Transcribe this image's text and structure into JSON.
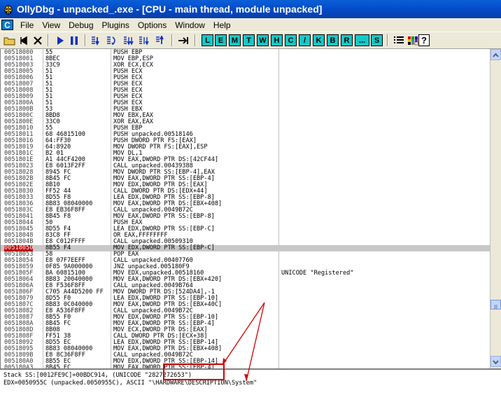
{
  "window": {
    "title": "OllyDbg - unpacked_.exe - [CPU - main thread, module unpacked]"
  },
  "menubar": {
    "mdi_icon_label": "C",
    "items": [
      "File",
      "View",
      "Debug",
      "Plugins",
      "Options",
      "Window",
      "Help"
    ]
  },
  "toolbar": {
    "letter_buttons": [
      "L",
      "E",
      "M",
      "T",
      "W",
      "H",
      "C",
      "/",
      "K",
      "B",
      "R",
      "...",
      "S"
    ],
    "glyph_buttons": [
      "open-icon",
      "restart-icon",
      "close-icon",
      "run-icon",
      "pause-icon",
      "step-into-icon",
      "step-over-icon",
      "trace-into-icon",
      "trace-over-icon",
      "execute-till-return-icon",
      "go-to-icon",
      "list-icon",
      "palette-icon",
      "help-icon"
    ]
  },
  "disassembly": {
    "selected_address": "00518050",
    "rows": [
      {
        "addr": "00518000",
        "hex": "55",
        "dis": "PUSH EBP",
        "com": ""
      },
      {
        "addr": "00518001",
        "hex": "8BEC",
        "dis": "MOV EBP,ESP",
        "com": ""
      },
      {
        "addr": "00518003",
        "hex": "33C9",
        "dis": "XOR ECX,ECX",
        "com": ""
      },
      {
        "addr": "00518005",
        "hex": "51",
        "dis": "PUSH ECX",
        "com": ""
      },
      {
        "addr": "00518006",
        "hex": "51",
        "dis": "PUSH ECX",
        "com": ""
      },
      {
        "addr": "00518007",
        "hex": "51",
        "dis": "PUSH ECX",
        "com": ""
      },
      {
        "addr": "00518008",
        "hex": "51",
        "dis": "PUSH ECX",
        "com": ""
      },
      {
        "addr": "00518009",
        "hex": "51",
        "dis": "PUSH ECX",
        "com": ""
      },
      {
        "addr": "0051800A",
        "hex": "51",
        "dis": "PUSH ECX",
        "com": ""
      },
      {
        "addr": "0051800B",
        "hex": "53",
        "dis": "PUSH EBX",
        "com": ""
      },
      {
        "addr": "0051800C",
        "hex": "8BD8",
        "dis": "MOV EBX,EAX",
        "com": ""
      },
      {
        "addr": "0051800E",
        "hex": "33C0",
        "dis": "XOR EAX,EAX",
        "com": ""
      },
      {
        "addr": "00518010",
        "hex": "55",
        "dis": "PUSH EBP",
        "com": ""
      },
      {
        "addr": "00518011",
        "hex": "68 46815100",
        "dis": "PUSH unpacked.00518146",
        "com": ""
      },
      {
        "addr": "00518016",
        "hex": "64:FF30",
        "dis": "PUSH DWORD PTR FS:[EAX]",
        "com": ""
      },
      {
        "addr": "00518019",
        "hex": "64:8920",
        "dis": "MOV DWORD PTR FS:[EAX],ESP",
        "com": ""
      },
      {
        "addr": "0051801C",
        "hex": "B2 01",
        "dis": "MOV DL,1",
        "com": ""
      },
      {
        "addr": "0051801E",
        "hex": "A1 44CF4200",
        "dis": "MOV EAX,DWORD PTR DS:[42CF44]",
        "com": ""
      },
      {
        "addr": "00518023",
        "hex": "E8 6013F2FF",
        "dis": "CALL unpacked.00439388",
        "com": ""
      },
      {
        "addr": "00518028",
        "hex": "8945 FC",
        "dis": "MOV DWORD PTR SS:[EBP-4],EAX",
        "com": ""
      },
      {
        "addr": "0051802B",
        "hex": "8B45 FC",
        "dis": "MOV EAX,DWORD PTR SS:[EBP-4]",
        "com": ""
      },
      {
        "addr": "0051802E",
        "hex": "8B10",
        "dis": "MOV EDX,DWORD PTR DS:[EAX]",
        "com": ""
      },
      {
        "addr": "00518030",
        "hex": "FF52 44",
        "dis": "CALL DWORD PTR DS:[EDX+44]",
        "com": ""
      },
      {
        "addr": "00518033",
        "hex": "8D55 F8",
        "dis": "LEA EDX,DWORD PTR SS:[EBP-8]",
        "com": ""
      },
      {
        "addr": "00518036",
        "hex": "8B83 08040000",
        "dis": "MOV EAX,DWORD PTR DS:[EBX+408]",
        "com": ""
      },
      {
        "addr": "0051803C",
        "hex": "E8 EB36F8FF",
        "dis": "CALL unpacked.0049B72C",
        "com": ""
      },
      {
        "addr": "00518041",
        "hex": "8B45 F8",
        "dis": "MOV EAX,DWORD PTR SS:[EBP-8]",
        "com": ""
      },
      {
        "addr": "00518044",
        "hex": "50",
        "dis": "PUSH EAX",
        "com": ""
      },
      {
        "addr": "00518045",
        "hex": "8D55 F4",
        "dis": "LEA EDX,DWORD PTR SS:[EBP-C]",
        "com": ""
      },
      {
        "addr": "00518048",
        "hex": "83C8 FF",
        "dis": "OR EAX,FFFFFFFF",
        "com": ""
      },
      {
        "addr": "0051804B",
        "hex": "E8 C012FFFF",
        "dis": "CALL unpacked.00509310",
        "com": ""
      },
      {
        "addr": "00518050",
        "hex": "8B55 F4",
        "dis": "MOV EDX,DWORD PTR SS:[EBP-C]",
        "com": ""
      },
      {
        "addr": "00518053",
        "hex": "58",
        "dis": "POP EAX",
        "com": ""
      },
      {
        "addr": "00518054",
        "hex": "E8 07F7EEFF",
        "dis": "CALL unpacked.00407760",
        "com": ""
      },
      {
        "addr": "00518059",
        "hex": "0F85 9A000000",
        "dis": "JNZ unpacked.005180F9",
        "com": ""
      },
      {
        "addr": "0051805F",
        "hex": "BA 60815100",
        "dis": "MOV EDX,unpacked.00518160",
        "com": "UNICODE \"Registered\""
      },
      {
        "addr": "00518064",
        "hex": "8B83 20040000",
        "dis": "MOV EAX,DWORD PTR DS:[EBX+420]",
        "com": ""
      },
      {
        "addr": "0051806A",
        "hex": "E8 F536F8FF",
        "dis": "CALL unpacked.0049B764",
        "com": ""
      },
      {
        "addr": "0051806F",
        "hex": "C705 A44D5200 FF",
        "dis": "MOV DWORD PTR DS:[524DA4],-1",
        "com": ""
      },
      {
        "addr": "00518079",
        "hex": "8D55 F0",
        "dis": "LEA EDX,DWORD PTR SS:[EBP-10]",
        "com": ""
      },
      {
        "addr": "0051807C",
        "hex": "8B83 0C040000",
        "dis": "MOV EAX,DWORD PTR DS:[EBX+40C]",
        "com": ""
      },
      {
        "addr": "00518082",
        "hex": "E8 A536F8FF",
        "dis": "CALL unpacked.0049B72C",
        "com": ""
      },
      {
        "addr": "00518087",
        "hex": "8B55 F0",
        "dis": "MOV EDX,DWORD PTR SS:[EBP-10]",
        "com": ""
      },
      {
        "addr": "0051808A",
        "hex": "8B45 FC",
        "dis": "MOV EAX,DWORD PTR SS:[EBP-4]",
        "com": ""
      },
      {
        "addr": "0051808D",
        "hex": "8B08",
        "dis": "MOV ECX,DWORD PTR DS:[EAX]",
        "com": ""
      },
      {
        "addr": "0051808F",
        "hex": "FF51 38",
        "dis": "CALL DWORD PTR DS:[ECX+38]",
        "com": ""
      },
      {
        "addr": "00518092",
        "hex": "8D55 EC",
        "dis": "LEA EDX,DWORD PTR SS:[EBP-14]",
        "com": ""
      },
      {
        "addr": "00518095",
        "hex": "8B83 08040000",
        "dis": "MOV EAX,DWORD PTR DS:[EBX+408]",
        "com": ""
      },
      {
        "addr": "0051809B",
        "hex": "E8 8C36F8FF",
        "dis": "CALL unpacked.0049B72C",
        "com": ""
      },
      {
        "addr": "005180A0",
        "hex": "8B55 EC",
        "dis": "MOV EDX,DWORD PTR SS:[EBP-14]",
        "com": ""
      },
      {
        "addr": "005180A3",
        "hex": "8B45 EC",
        "dis": "MOV EAX,DWORD PTR SS:[EBP-4]",
        "com": ""
      }
    ]
  },
  "info_pane": {
    "line1": "Stack SS:[0012FE9C]=00BDC914, (UNICODE \"2827272653\")",
    "line2": "EDX=0050955C (unpacked.0050955C), ASCII \"\\HARDWARE\\DESCRIPTION\\System\"",
    "highlighted_value": "\"2827272653\")"
  },
  "colors": {
    "titlebar": "#0448c4",
    "selected_address_bg": "#c00000",
    "selected_row_bg": "#c8c8c8",
    "annotation": "#d40000",
    "toolbar_letter_bg": "#14c8c8"
  }
}
